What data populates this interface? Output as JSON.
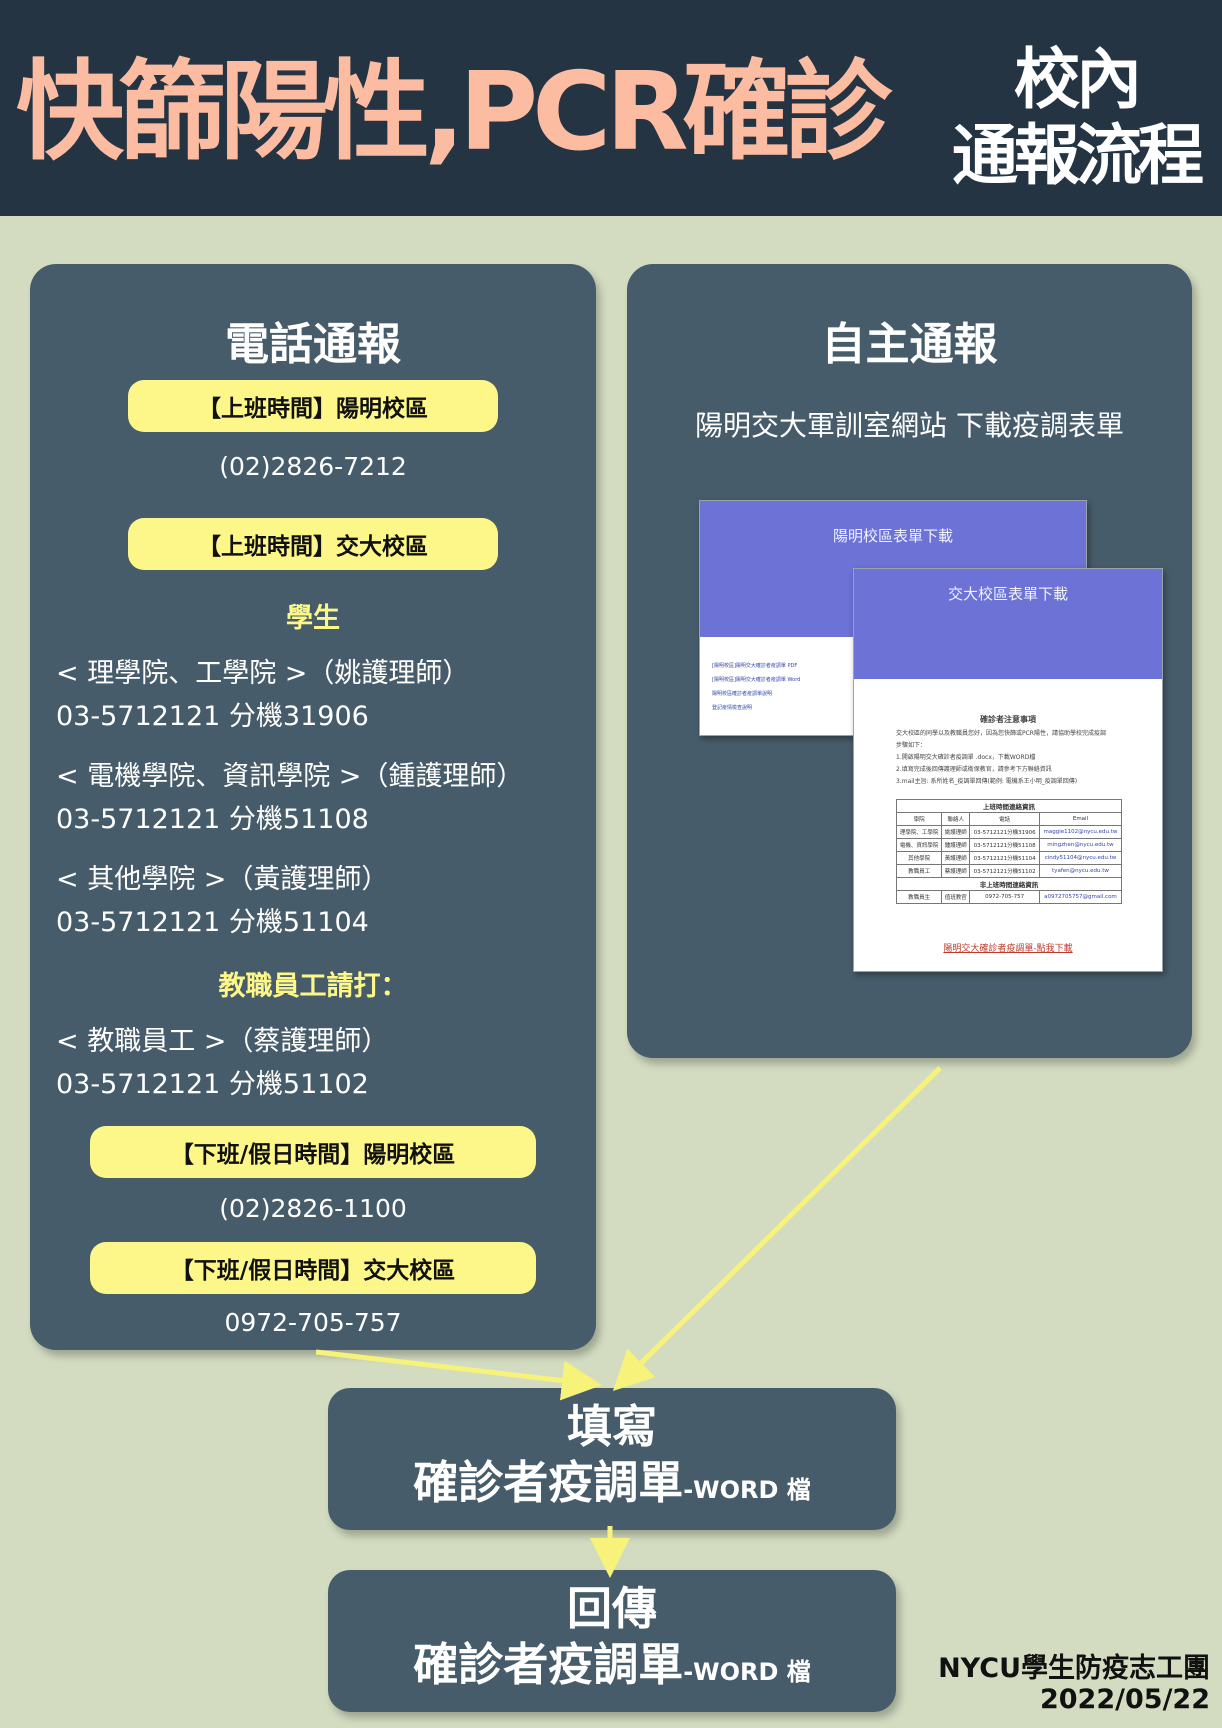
{
  "header": {
    "main_title": "快篩陽性,PCR確診",
    "side_title_line1": "校內",
    "side_title_line2": "通報流程"
  },
  "phone_panel": {
    "title": "電話通報",
    "office_yangming_label": "【上班時間】陽明校區",
    "office_yangming_phone": "(02)2826-7212",
    "office_jiaoda_label": "【上班時間】交大校區",
    "students_heading": "學生",
    "contacts": [
      {
        "unit": "< 理學院、工學院 >（姚護理師）",
        "phone": "03-5712121 分機31906"
      },
      {
        "unit": "< 電機學院、資訊學院 >（鍾護理師）",
        "phone": "03-5712121 分機51108"
      },
      {
        "unit": "< 其他學院 >（黃護理師）",
        "phone": "03-5712121 分機51104"
      }
    ],
    "staff_heading": "教職員工請打：",
    "staff_contact": {
      "unit": "< 教職員工 >（蔡護理師）",
      "phone": "03-5712121 分機51102"
    },
    "offhours_yangming_label": "【下班/假日時間】陽明校區",
    "offhours_yangming_phone": "(02)2826-1100",
    "offhours_jiaoda_label": "【下班/假日時間】交大校區",
    "offhours_jiaoda_phone": "0972-705-757"
  },
  "self_panel": {
    "title": "自主通報",
    "site_text": "陽明交大軍訓室網站 下載疫調表單",
    "doc_back_banner": "陽明校區表單下載",
    "doc_back_lines": [
      "[陽明校區]陽明交大確診者疫調單 PDF",
      "[陽明校區]陽明交大確診者疫調單 Word",
      "陽明校區確診者疫調單說明",
      "登記疫情檢查說明"
    ],
    "doc_front_banner": "交大校區表單下載",
    "doc_front_heading": "確診者注意事項",
    "doc_front_lines": [
      "交大校區的同學以及教職員您好，因為您快篩或PCR陽性，請協助學校完成疫調",
      "步驟如下：",
      "1.開啟陽明交大確診者疫調單 .docx，下載WORD檔",
      "2.填寫完成後回傳護理師或衛保教官，請參考下方聯絡資訊",
      "3.mail主旨: 系所姓名_疫調單回傳(範例: 電機系王小明_疫調單回傳)"
    ],
    "doc_table_title_1": "上班時間連絡資訊",
    "doc_table_header": [
      "學院",
      "聯絡人",
      "電話",
      "Email"
    ],
    "doc_table_rows": [
      [
        "理學院、工學院",
        "姚護理師",
        "03-5712121分機31906",
        "maggie1102@nycu.edu.tw"
      ],
      [
        "電機、資訊學院",
        "鍾護理師",
        "03-5712121分機51108",
        "mingzhen@nycu.edu.tw"
      ],
      [
        "其他學院",
        "黃護理師",
        "03-5712121分機51104",
        "cindy51104@nycu.edu.tw"
      ],
      [
        "教職員工",
        "蔡護理師",
        "03-5712121分機51102",
        "tyafen@nycu.edu.tw"
      ]
    ],
    "doc_table_title_2": "非上班時間連絡資訊",
    "doc_table_row_offhours": [
      "教職員生",
      "值班教官",
      "0972-705-757",
      "a0972705757@gmail.com"
    ],
    "doc_front_link": "陽明交大確診者疫調單-點我下載"
  },
  "flow": {
    "fill_line1": "填寫",
    "fill_line2": "確診者疫調單",
    "fill_suffix": "-WORD 檔",
    "return_line1": "回傳",
    "return_line2": "確診者疫調單",
    "return_suffix": "-WORD 檔"
  },
  "credit": {
    "org": "NYCU學生防疫志工團",
    "date": "2022/05/22"
  },
  "colors": {
    "header_bg": "#243443",
    "title_peach": "#fbbca2",
    "panel": "#475c6a",
    "page_bg": "#d3dcc1",
    "pill_yellow": "#fcf788",
    "arrow_yellow": "#f7f27a"
  }
}
